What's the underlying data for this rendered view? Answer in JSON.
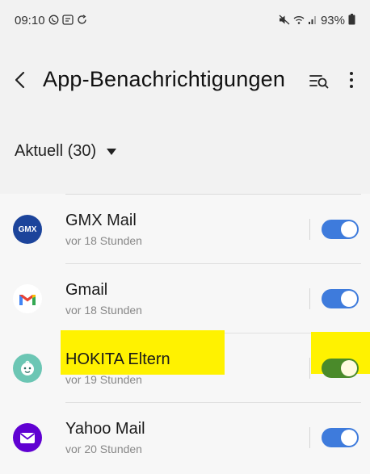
{
  "status": {
    "time": "09:10",
    "battery": "93%"
  },
  "header": {
    "title": "App-Benachrichtigungen"
  },
  "filter": {
    "label": "Aktuell (30)"
  },
  "apps": [
    {
      "name": "GMX Mail",
      "time": "vor 18 Stunden",
      "enabled": true,
      "icon_text": "GMX"
    },
    {
      "name": "Gmail",
      "time": "vor 18 Stunden",
      "enabled": true
    },
    {
      "name": "HOKITA Eltern",
      "time": "vor 19 Stunden",
      "enabled": true
    },
    {
      "name": "Yahoo Mail",
      "time": "vor 20 Stunden",
      "enabled": true
    }
  ],
  "colors": {
    "toggle_on": "#3e7bdc",
    "highlight": "#fff200",
    "gmx": "#1c449b",
    "hokita": "#6cc6b4",
    "yahoo": "#6001d2"
  }
}
